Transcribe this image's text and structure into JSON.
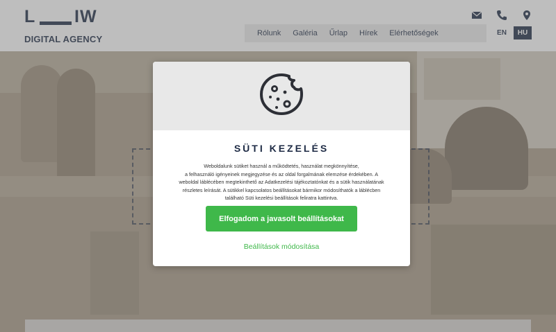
{
  "logo": {
    "left": "L",
    "right": "IW",
    "tagline": "DIGITAL AGENCY"
  },
  "header": {
    "icons": [
      "mail-icon",
      "phone-icon",
      "location-icon"
    ],
    "nav": [
      "Rólunk",
      "Galéria",
      "Űrlap",
      "Hírek",
      "Elérhetőségek"
    ],
    "languages": [
      "EN",
      "HU"
    ],
    "active_language": "HU"
  },
  "modal": {
    "icon": "cookie-icon",
    "title": "SÜTI KEZELÉS",
    "text_lines": [
      "Weboldalunk sütiket használ a működtetés, használat megkönnyítése,",
      "a felhasználó igényeinek megjegyzése és az oldal forgalmának elemzése érdekében. A",
      "weboldal láblécében megtekinthető az Adatkezelési tájékoztatónkat és a sütik használatának",
      "részletes leírását. A sütikkel kapcsolatos beállításokat bármikor módosíthatók a láblécben",
      "található Süti kezelési beállítások feliratra kattintva."
    ],
    "accept_label": "Elfogadom a javasolt beállításokat",
    "settings_label": "Beállítások módosítása"
  },
  "colors": {
    "brand_dark": "#1d2a44",
    "accept_green": "#3fb84a",
    "modal_top_gray": "#e8e8e8"
  }
}
